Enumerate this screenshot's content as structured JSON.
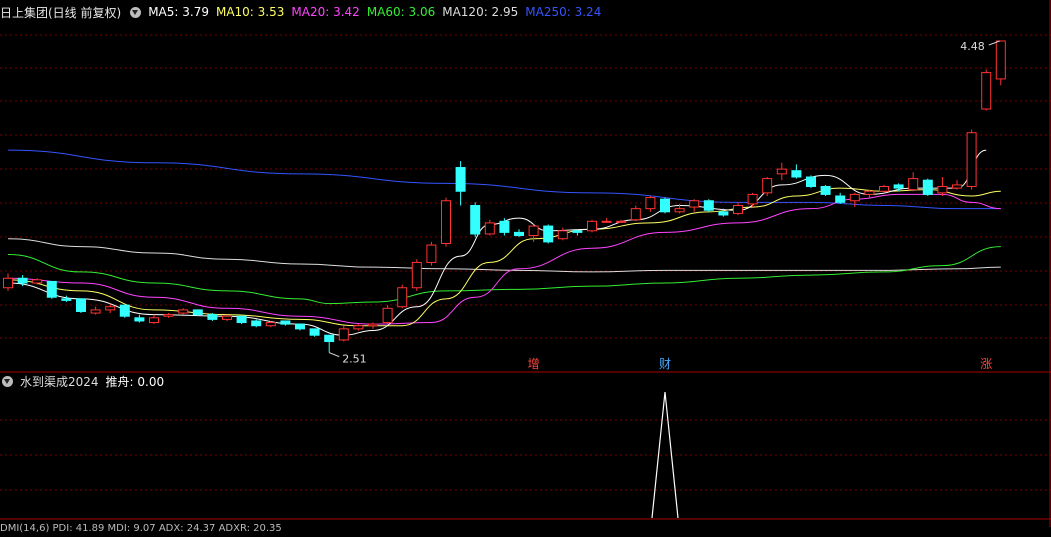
{
  "title": "日上集团(日线 前复权)",
  "ma_legend": [
    {
      "label": "MA5: 3.79",
      "color": "#ffffff"
    },
    {
      "label": "MA10: 3.53",
      "color": "#ffff66"
    },
    {
      "label": "MA20: 3.42",
      "color": "#ff44ff"
    },
    {
      "label": "MA60: 3.06",
      "color": "#33ee33"
    },
    {
      "label": "MA120: 2.95",
      "color": "#dddddd"
    },
    {
      "label": "MA250: 3.24",
      "color": "#3355ff"
    }
  ],
  "indicator": {
    "name": "水到渠成2024",
    "value_label": "推舟: 0.00",
    "signal_color": "#ffffff"
  },
  "bottom_partial": "DMI(14,6) PDI: 41.89 MDI: 9.07 ADX: 24.37 ADXR: 20.35",
  "markers": [
    {
      "label": "增",
      "index": 36,
      "color": "#ff4444"
    },
    {
      "label": "财",
      "index": 45,
      "color": "#44aaff"
    },
    {
      "label": "涨",
      "index": 67,
      "color": "#ff4444"
    }
  ],
  "colors": {
    "up": "#ff3333",
    "down": "#33ffff",
    "grid": "#7a0000",
    "bg": "#000000"
  },
  "chart_data": {
    "type": "candlestick",
    "price_range": [
      2.4,
      4.6
    ],
    "high_label": "4.48",
    "low_label": "2.51",
    "high_index": 68,
    "low_index": 22,
    "candles": [
      [
        2.92,
        2.98,
        3.01,
        2.9
      ],
      [
        2.98,
        2.95,
        3.0,
        2.93
      ],
      [
        2.95,
        2.97,
        2.98,
        2.94
      ],
      [
        2.96,
        2.86,
        2.96,
        2.85
      ],
      [
        2.85,
        2.84,
        2.87,
        2.83
      ],
      [
        2.85,
        2.77,
        2.85,
        2.76
      ],
      [
        2.76,
        2.78,
        2.8,
        2.75
      ],
      [
        2.78,
        2.8,
        2.82,
        2.76
      ],
      [
        2.81,
        2.74,
        2.81,
        2.73
      ],
      [
        2.73,
        2.71,
        2.75,
        2.7
      ],
      [
        2.7,
        2.73,
        2.75,
        2.69
      ],
      [
        2.74,
        2.75,
        2.76,
        2.73
      ],
      [
        2.76,
        2.78,
        2.79,
        2.75
      ],
      [
        2.78,
        2.75,
        2.78,
        2.74
      ],
      [
        2.75,
        2.72,
        2.76,
        2.71
      ],
      [
        2.72,
        2.74,
        2.75,
        2.71
      ],
      [
        2.74,
        2.7,
        2.74,
        2.69
      ],
      [
        2.71,
        2.68,
        2.72,
        2.67
      ],
      [
        2.68,
        2.7,
        2.71,
        2.67
      ],
      [
        2.71,
        2.69,
        2.71,
        2.68
      ],
      [
        2.69,
        2.66,
        2.69,
        2.65
      ],
      [
        2.66,
        2.62,
        2.66,
        2.61
      ],
      [
        2.62,
        2.58,
        2.62,
        2.51
      ],
      [
        2.59,
        2.66,
        2.68,
        2.58
      ],
      [
        2.66,
        2.68,
        2.69,
        2.65
      ],
      [
        2.68,
        2.69,
        2.7,
        2.66
      ],
      [
        2.7,
        2.79,
        2.81,
        2.69
      ],
      [
        2.8,
        2.92,
        2.94,
        2.79
      ],
      [
        2.92,
        3.08,
        3.1,
        2.9
      ],
      [
        3.08,
        3.19,
        3.21,
        3.06
      ],
      [
        3.2,
        3.47,
        3.49,
        3.18
      ],
      [
        3.68,
        3.53,
        3.72,
        3.44
      ],
      [
        3.44,
        3.26,
        3.46,
        3.24
      ],
      [
        3.26,
        3.33,
        3.35,
        3.25
      ],
      [
        3.34,
        3.27,
        3.36,
        3.25
      ],
      [
        3.27,
        3.25,
        3.29,
        3.24
      ],
      [
        3.25,
        3.31,
        3.32,
        3.21
      ],
      [
        3.31,
        3.21,
        3.32,
        3.2
      ],
      [
        3.23,
        3.28,
        3.3,
        3.22
      ],
      [
        3.28,
        3.27,
        3.29,
        3.25
      ],
      [
        3.28,
        3.34,
        3.35,
        3.27
      ],
      [
        3.34,
        3.34,
        3.36,
        3.33
      ],
      [
        3.34,
        3.34,
        3.35,
        3.33
      ],
      [
        3.35,
        3.42,
        3.44,
        3.34
      ],
      [
        3.42,
        3.49,
        3.5,
        3.4
      ],
      [
        3.48,
        3.4,
        3.49,
        3.39
      ],
      [
        3.4,
        3.42,
        3.45,
        3.39
      ],
      [
        3.43,
        3.47,
        3.48,
        3.4
      ],
      [
        3.47,
        3.41,
        3.48,
        3.4
      ],
      [
        3.4,
        3.38,
        3.42,
        3.37
      ],
      [
        3.39,
        3.44,
        3.46,
        3.38
      ],
      [
        3.45,
        3.51,
        3.52,
        3.43
      ],
      [
        3.52,
        3.61,
        3.62,
        3.5
      ],
      [
        3.64,
        3.67,
        3.71,
        3.6
      ],
      [
        3.66,
        3.62,
        3.7,
        3.61
      ],
      [
        3.62,
        3.56,
        3.63,
        3.55
      ],
      [
        3.56,
        3.51,
        3.57,
        3.5
      ],
      [
        3.5,
        3.46,
        3.52,
        3.45
      ],
      [
        3.47,
        3.51,
        3.52,
        3.43
      ],
      [
        3.51,
        3.53,
        3.54,
        3.49
      ],
      [
        3.53,
        3.56,
        3.57,
        3.52
      ],
      [
        3.57,
        3.55,
        3.58,
        3.53
      ],
      [
        3.54,
        3.61,
        3.65,
        3.53
      ],
      [
        3.6,
        3.51,
        3.61,
        3.5
      ],
      [
        3.52,
        3.56,
        3.62,
        3.5
      ],
      [
        3.55,
        3.57,
        3.6,
        3.54
      ],
      [
        3.56,
        3.9,
        3.92,
        3.54
      ],
      [
        4.05,
        4.28,
        4.3,
        4.04
      ],
      [
        4.24,
        4.48,
        4.48,
        4.2
      ]
    ],
    "ma_lines": [
      {
        "name": "MA5",
        "color": "#ffffff",
        "points": [
          [
            0,
            2.95
          ],
          [
            5,
            2.85
          ],
          [
            10,
            2.75
          ],
          [
            15,
            2.74
          ],
          [
            20,
            2.69
          ],
          [
            23,
            2.62
          ],
          [
            25,
            2.65
          ],
          [
            28,
            2.8
          ],
          [
            31,
            3.12
          ],
          [
            33,
            3.32
          ],
          [
            35,
            3.36
          ],
          [
            37,
            3.28
          ],
          [
            40,
            3.29
          ],
          [
            43,
            3.35
          ],
          [
            46,
            3.44
          ],
          [
            50,
            3.41
          ],
          [
            53,
            3.57
          ],
          [
            56,
            3.63
          ],
          [
            59,
            3.51
          ],
          [
            62,
            3.55
          ],
          [
            65,
            3.55
          ],
          [
            67,
            3.79
          ]
        ]
      },
      {
        "name": "MA10",
        "color": "#ffff66",
        "points": [
          [
            0,
            2.97
          ],
          [
            5,
            2.9
          ],
          [
            10,
            2.78
          ],
          [
            15,
            2.75
          ],
          [
            20,
            2.72
          ],
          [
            24,
            2.68
          ],
          [
            27,
            2.68
          ],
          [
            30,
            2.85
          ],
          [
            33,
            3.08
          ],
          [
            36,
            3.23
          ],
          [
            40,
            3.29
          ],
          [
            44,
            3.33
          ],
          [
            48,
            3.4
          ],
          [
            51,
            3.43
          ],
          [
            54,
            3.5
          ],
          [
            57,
            3.55
          ],
          [
            60,
            3.53
          ],
          [
            63,
            3.54
          ],
          [
            66,
            3.5
          ],
          [
            68,
            3.53
          ]
        ]
      },
      {
        "name": "MA20",
        "color": "#ff44ff",
        "points": [
          [
            0,
            2.98
          ],
          [
            5,
            2.95
          ],
          [
            10,
            2.86
          ],
          [
            15,
            2.79
          ],
          [
            20,
            2.74
          ],
          [
            25,
            2.69
          ],
          [
            29,
            2.7
          ],
          [
            32,
            2.86
          ],
          [
            35,
            3.04
          ],
          [
            40,
            3.17
          ],
          [
            45,
            3.27
          ],
          [
            50,
            3.33
          ],
          [
            55,
            3.42
          ],
          [
            58,
            3.48
          ],
          [
            61,
            3.51
          ],
          [
            64,
            3.51
          ],
          [
            66,
            3.46
          ],
          [
            68,
            3.42
          ]
        ]
      },
      {
        "name": "MA60",
        "color": "#33ee33",
        "points": [
          [
            0,
            3.13
          ],
          [
            5,
            3.02
          ],
          [
            10,
            2.95
          ],
          [
            15,
            2.9
          ],
          [
            20,
            2.85
          ],
          [
            22,
            2.82
          ],
          [
            25,
            2.83
          ],
          [
            30,
            2.9
          ],
          [
            35,
            2.91
          ],
          [
            40,
            2.93
          ],
          [
            45,
            2.95
          ],
          [
            50,
            2.98
          ],
          [
            55,
            3.0
          ],
          [
            60,
            3.02
          ],
          [
            64,
            3.06
          ],
          [
            68,
            3.18
          ]
        ]
      },
      {
        "name": "MA120",
        "color": "#dddddd",
        "points": [
          [
            0,
            3.23
          ],
          [
            5,
            3.18
          ],
          [
            10,
            3.14
          ],
          [
            15,
            3.1
          ],
          [
            20,
            3.07
          ],
          [
            25,
            3.05
          ],
          [
            30,
            3.04
          ],
          [
            35,
            3.03
          ],
          [
            40,
            3.02
          ],
          [
            45,
            3.03
          ],
          [
            50,
            3.03
          ],
          [
            55,
            3.03
          ],
          [
            60,
            3.03
          ],
          [
            65,
            3.04
          ],
          [
            68,
            3.05
          ]
        ]
      },
      {
        "name": "MA250",
        "color": "#3355ff",
        "points": [
          [
            0,
            3.79
          ],
          [
            10,
            3.71
          ],
          [
            20,
            3.64
          ],
          [
            30,
            3.58
          ],
          [
            40,
            3.52
          ],
          [
            50,
            3.46
          ],
          [
            55,
            3.46
          ],
          [
            60,
            3.44
          ],
          [
            65,
            3.42
          ],
          [
            68,
            3.42
          ]
        ]
      }
    ],
    "indicator_spike": {
      "index": 45,
      "value": 1.0
    }
  }
}
